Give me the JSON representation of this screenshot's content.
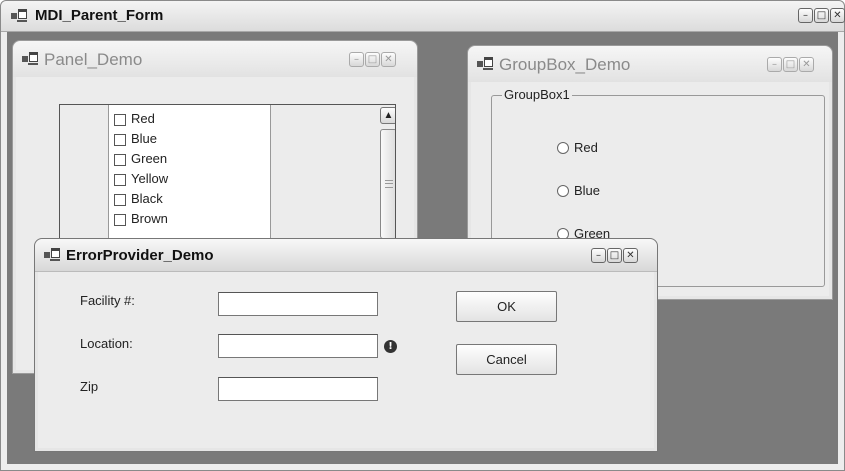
{
  "parent": {
    "title": "MDI_Parent_Form",
    "controls": {
      "minimize": "–",
      "maximize": "□",
      "close": "✕"
    }
  },
  "panel_demo": {
    "title": "Panel_Demo",
    "controls": {
      "minimize": "–",
      "maximize": "□",
      "close": "✕"
    },
    "items": [
      "Red",
      "Blue",
      "Green",
      "Yellow",
      "Black",
      "Brown"
    ],
    "scroll_up": "▲"
  },
  "groupbox_demo": {
    "title": "GroupBox_Demo",
    "controls": {
      "minimize": "–",
      "maximize": "□",
      "close": "✕"
    },
    "group_label": "GroupBox1",
    "options": [
      "Red",
      "Blue",
      "Green"
    ]
  },
  "error_provider_demo": {
    "title": "ErrorProvider_Demo",
    "controls": {
      "minimize": "–",
      "maximize": "□",
      "close": "✕"
    },
    "fields": {
      "facility_label": "Facility #:",
      "facility_value": "",
      "location_label": "Location:",
      "location_value": "",
      "zip_label": "Zip",
      "zip_value": ""
    },
    "error_icon": "!",
    "ok_label": "OK",
    "cancel_label": "Cancel"
  },
  "icons": {
    "window_icon": "window-app-icon",
    "error_icon": "exclamation-circle-icon"
  }
}
